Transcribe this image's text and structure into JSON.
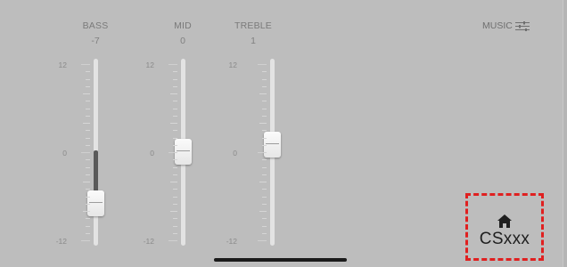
{
  "bands": [
    {
      "id": "bass",
      "name": "BASS",
      "value_label": "-7",
      "value": -7
    },
    {
      "id": "mid",
      "name": "MID",
      "value_label": "0",
      "value": 0
    },
    {
      "id": "treble",
      "name": "TREBLE",
      "value_label": "1",
      "value": 1
    }
  ],
  "scale": {
    "max_label": "12",
    "mid_label": "0",
    "min_label": "-12"
  },
  "mode": {
    "label": "MUSIC",
    "icon": "sliders-icon"
  },
  "home_shortcut": {
    "label": "CSxxx",
    "icon": "home-icon",
    "highlight_color": "#e02020"
  }
}
